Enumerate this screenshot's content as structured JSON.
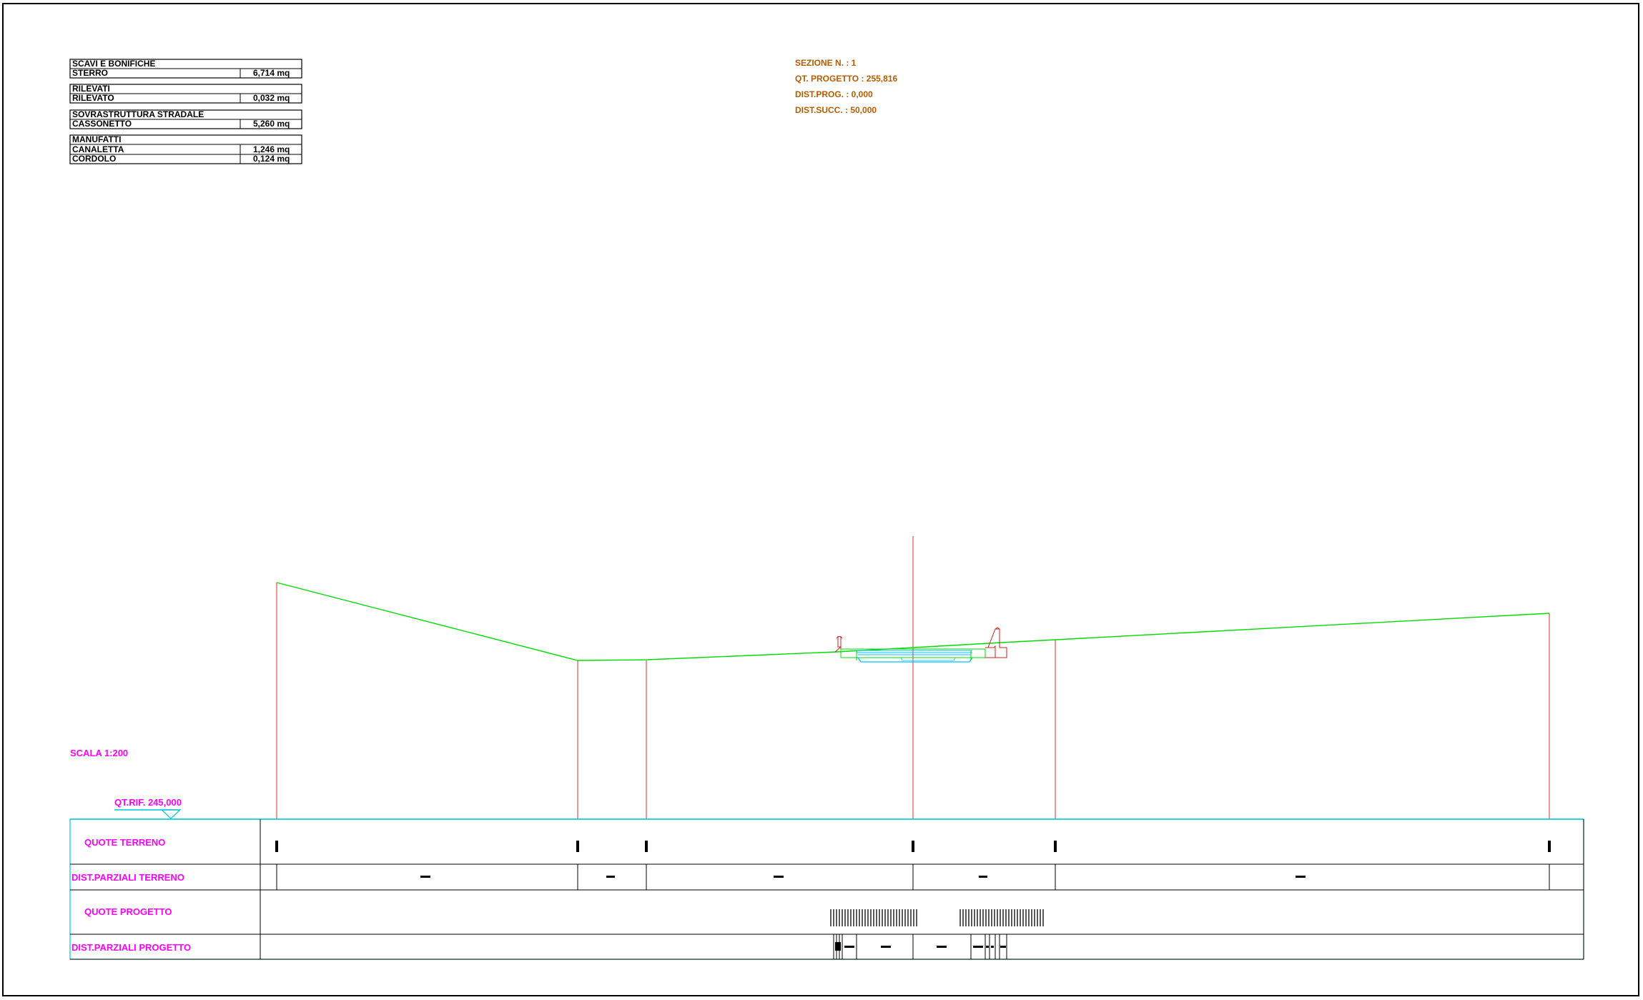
{
  "quantities": {
    "groups": [
      {
        "title": "SCAVI E BONIFICHE",
        "rows": [
          {
            "label": "STERRO",
            "value": "6,714 mq"
          }
        ]
      },
      {
        "title": "RILEVATI",
        "rows": [
          {
            "label": "RILEVATO",
            "value": "0,032 mq"
          }
        ]
      },
      {
        "title": "SOVRASTRUTTURA STRADALE",
        "rows": [
          {
            "label": "CASSONETTO",
            "value": "5,260 mq"
          }
        ]
      },
      {
        "title": "MANUFATTI",
        "rows": [
          {
            "label": "CANALETTA",
            "value": "1,246 mq"
          },
          {
            "label": "CORDOLO",
            "value": "0,124 mq"
          }
        ]
      }
    ]
  },
  "section_info": {
    "sezione": "SEZIONE N. : 1",
    "qt_progetto": "QT. PROGETTO : 255,816",
    "dist_prog": "DIST.PROG. : 0,000",
    "dist_succ": "DIST.SUCC. : 50,000"
  },
  "scale_label": "SCALA 1:200",
  "reference_label": "QT.RIF. 245,000",
  "band_labels": {
    "quote_terreno": "QUOTE TERRENO",
    "dist_parziali_terreno": "DIST.PARZIALI TERRENO",
    "quote_progetto": "QUOTE PROGETTO",
    "dist_parziali_progetto": "DIST.PARZIALI PROGETTO"
  },
  "colors": {
    "frame": "#000000",
    "terrain": "#00dd00",
    "vertical_marker": "#e05050",
    "band_border": "#00c8d0",
    "band_label": "#ff00ff",
    "info_text": "#b85c00",
    "road_body": "#00bfff",
    "structure": "#cc2222"
  }
}
